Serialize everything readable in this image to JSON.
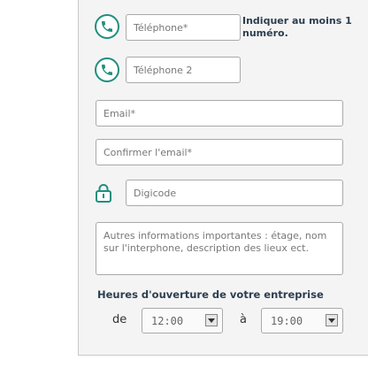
{
  "contact": {
    "phone1_placeholder": "Téléphone*",
    "phone2_placeholder": "Téléphone 2",
    "phone_note": "Indiquer au moins 1 numéro.",
    "email_placeholder": "Email*",
    "confirm_email_placeholder": "Confirmer l'email*",
    "digicode_placeholder": "Digicode",
    "other_info_placeholder": "Autres informations importantes : étage, nom\nsur l'interphone, description des lieux ect."
  },
  "hours": {
    "title": "Heures d'ouverture de votre entreprise",
    "from_label": "de",
    "to_label": "à",
    "from_value": "12:00",
    "to_value": "19:00"
  },
  "colors": {
    "accent": "#1f8f7f",
    "heading": "#2c3e50"
  },
  "icons": {
    "phone": "phone-icon",
    "lock": "lock-icon",
    "dropdown": "dropdown-arrow-icon"
  }
}
